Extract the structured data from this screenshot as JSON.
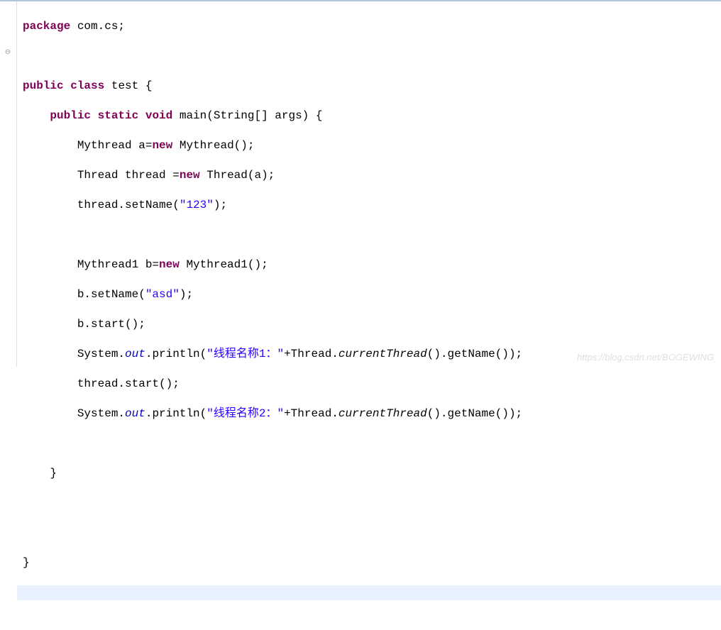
{
  "code": {
    "line1": {
      "kw_package": "package",
      "text": " com.cs;"
    },
    "line3": {
      "kw_public": "public",
      "kw_class": "class",
      "text_test": " test {"
    },
    "line4": {
      "kw_public": "public",
      "kw_static": "static",
      "kw_void": "void",
      "text_main": " main(String[] args) {"
    },
    "line5": {
      "text_a": "Mythread a=",
      "kw_new": "new",
      "text_b": " Mythread();"
    },
    "line6": {
      "text_a": "Thread thread =",
      "kw_new": "new",
      "text_b": " Thread(a);"
    },
    "line7": {
      "text_a": "thread.setName(",
      "str": "\"123\"",
      "text_b": ");"
    },
    "line9": {
      "text_a": "Mythread1 b=",
      "kw_new": "new",
      "text_b": " Mythread1();"
    },
    "line10": {
      "text_a": "b.setName(",
      "str": "\"asd\"",
      "text_b": ");"
    },
    "line11": {
      "text": "b.start();"
    },
    "line12": {
      "text_a": "System.",
      "out": "out",
      "text_b": ".println(",
      "str": "\"线程名称1：\"",
      "text_c": "+Thread.",
      "method": "currentThread",
      "text_d": "().getName());"
    },
    "line13": {
      "text": "thread.start();"
    },
    "line14": {
      "text_a": "System.",
      "out": "out",
      "text_b": ".println(",
      "str": "\"线程名称2：\"",
      "text_c": "+Thread.",
      "method": "currentThread",
      "text_d": "().getName());"
    },
    "line16": {
      "text": "}"
    },
    "line19": {
      "text": "}"
    }
  },
  "watermark": "https://blog.csdn.net/BOGEWING",
  "indent1": "    ",
  "indent2": "        ",
  "indent3": "            "
}
